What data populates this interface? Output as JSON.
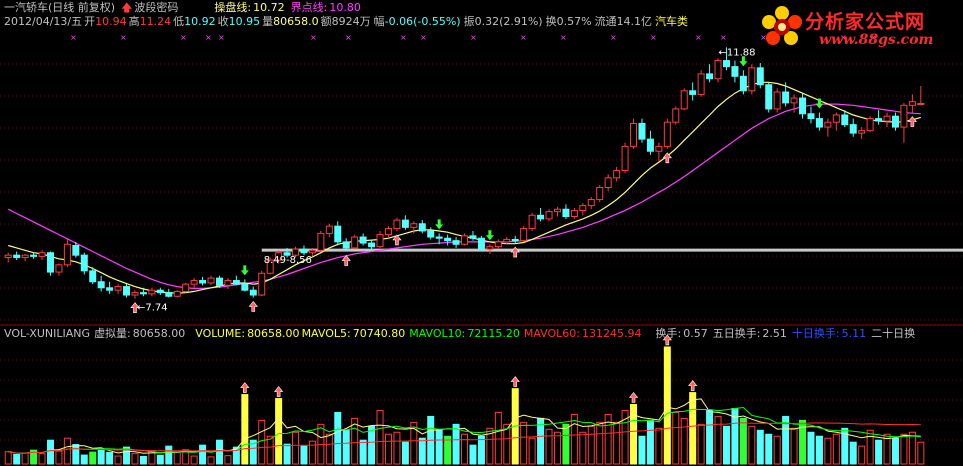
{
  "header": {
    "title": "一汽轿车(日线 前复权)",
    "indicator_name": "波段密码",
    "cao_pan_label": "操盘线:",
    "cao_pan_value": "10.72",
    "jie_dian_label": "界点线:",
    "jie_dian_value": "10.80"
  },
  "quote": {
    "date": "2012/04/13/五",
    "open_label": "开",
    "open": "10.94",
    "high_label": "高",
    "high": "11.24",
    "low_label": "低",
    "low": "10.92",
    "close_label": "收",
    "close": "10.95",
    "vol_label": "量",
    "volume": "80658.0",
    "amount_label": "额",
    "amount": "8924万",
    "change_label": "幅",
    "change": "-0.06(-0.55%)",
    "amplitude_label": "振",
    "amplitude": "0.32(2.91%)",
    "turnover_label": "换",
    "turnover": "0.57%",
    "float_label": "流通",
    "float_cap": "14.1亿",
    "sector": "汽车类"
  },
  "logo": {
    "name": "分析家公式网",
    "url": "www.88gs.com"
  },
  "volume_panel": {
    "indicator": "VOL-XUNILIANG",
    "virtual_vol_label": "虚拟量:",
    "virtual_vol": "80658.00",
    "volume_label": "VOLUME:",
    "volume": "80658.00",
    "mavol5_label": "MAVOL5:",
    "mavol5": "70740.80",
    "mavol10_label": "MAVOL10:",
    "mavol10": "72115.20",
    "mavol60_label": "MAVOL60:",
    "mavol60": "131245.94",
    "turn_label": "换手:",
    "turn": "0.57",
    "turn5_label": "五日换手:",
    "turn5": "2.51",
    "turn10_label": "十日换手:",
    "turn10": "5.11",
    "turn20_label": "二十日换"
  },
  "colors": {
    "up": "#ff3c3c",
    "down": "#54ffff",
    "ma_yellow": "#ffff80",
    "ma_magenta": "#ff40ff",
    "grid": "#800000",
    "text": "#c0c0c0",
    "green_text": "#00d000",
    "blue_text": "#3050ff",
    "mavol10_green": "#00ff00",
    "mavol60_red": "#ff3030",
    "yellow_bar": "#ffff40"
  },
  "chart_data": {
    "type": "candlestick",
    "annotations": [
      {
        "text": "11.88",
        "kind": "peak"
      },
      {
        "text": "7.74",
        "kind": "trough"
      },
      {
        "text": "8.49-8.56",
        "kind": "level"
      }
    ],
    "series": [
      {
        "name": "操盘线"
      },
      {
        "name": "界点线"
      }
    ],
    "candles": [
      [
        8.4,
        8.48,
        8.32,
        8.44
      ],
      [
        8.44,
        8.5,
        8.36,
        8.4
      ],
      [
        8.4,
        8.46,
        8.34,
        8.44
      ],
      [
        8.44,
        8.48,
        8.38,
        8.42
      ],
      [
        8.42,
        8.52,
        8.36,
        8.48
      ],
      [
        8.48,
        8.5,
        8.1,
        8.16
      ],
      [
        8.16,
        8.3,
        8.1,
        8.28
      ],
      [
        8.28,
        8.7,
        8.24,
        8.62
      ],
      [
        8.6,
        8.66,
        8.4,
        8.44
      ],
      [
        8.44,
        8.48,
        8.12,
        8.18
      ],
      [
        8.18,
        8.24,
        7.96,
        8.0
      ],
      [
        8.0,
        8.1,
        7.84,
        7.9
      ],
      [
        7.9,
        8.0,
        7.8,
        7.86
      ],
      [
        7.86,
        7.96,
        7.8,
        7.92
      ],
      [
        7.92,
        7.96,
        7.74,
        7.78
      ],
      [
        7.78,
        7.86,
        7.72,
        7.82
      ],
      [
        7.82,
        7.9,
        7.76,
        7.8
      ],
      [
        7.8,
        7.9,
        7.76,
        7.86
      ],
      [
        7.86,
        7.9,
        7.78,
        7.82
      ],
      [
        7.82,
        7.88,
        7.74,
        7.76
      ],
      [
        7.76,
        7.86,
        7.74,
        7.84
      ],
      [
        7.84,
        7.98,
        7.82,
        7.96
      ],
      [
        7.96,
        8.06,
        7.9,
        8.02
      ],
      [
        8.02,
        8.08,
        7.94,
        7.98
      ],
      [
        7.98,
        8.1,
        7.94,
        8.06
      ],
      [
        8.06,
        8.1,
        7.9,
        7.94
      ],
      [
        7.94,
        8.06,
        7.88,
        8.02
      ],
      [
        8.02,
        8.1,
        7.94,
        7.96
      ],
      [
        7.96,
        8.04,
        7.84,
        7.86
      ],
      [
        7.86,
        7.92,
        7.74,
        7.78
      ],
      [
        7.78,
        8.18,
        7.76,
        8.14
      ],
      [
        8.14,
        8.4,
        8.12,
        8.36
      ],
      [
        8.36,
        8.52,
        8.3,
        8.48
      ],
      [
        8.48,
        8.56,
        8.4,
        8.44
      ],
      [
        8.44,
        8.58,
        8.4,
        8.54
      ],
      [
        8.54,
        8.6,
        8.44,
        8.48
      ],
      [
        8.48,
        8.56,
        8.42,
        8.52
      ],
      [
        8.52,
        8.84,
        8.5,
        8.8
      ],
      [
        8.8,
        8.96,
        8.74,
        8.92
      ],
      [
        8.92,
        9.0,
        8.6,
        8.66
      ],
      [
        8.66,
        8.72,
        8.5,
        8.56
      ],
      [
        8.56,
        8.78,
        8.54,
        8.74
      ],
      [
        8.74,
        8.8,
        8.6,
        8.64
      ],
      [
        8.64,
        8.7,
        8.54,
        8.58
      ],
      [
        8.58,
        8.84,
        8.56,
        8.78
      ],
      [
        8.78,
        8.92,
        8.72,
        8.88
      ],
      [
        8.88,
        9.06,
        8.84,
        9.02
      ],
      [
        9.02,
        9.1,
        8.86,
        8.9
      ],
      [
        8.9,
        9.0,
        8.8,
        8.96
      ],
      [
        8.96,
        9.02,
        8.8,
        8.84
      ],
      [
        8.84,
        8.9,
        8.7,
        8.74
      ],
      [
        8.74,
        8.8,
        8.62,
        8.72
      ],
      [
        8.72,
        8.78,
        8.6,
        8.68
      ],
      [
        8.68,
        8.74,
        8.56,
        8.62
      ],
      [
        8.62,
        8.8,
        8.6,
        8.76
      ],
      [
        8.76,
        8.84,
        8.68,
        8.72
      ],
      [
        8.72,
        8.76,
        8.5,
        8.54
      ],
      [
        8.54,
        8.62,
        8.46,
        8.58
      ],
      [
        8.58,
        8.7,
        8.54,
        8.66
      ],
      [
        8.66,
        8.74,
        8.62,
        8.7
      ],
      [
        8.7,
        8.76,
        8.64,
        8.68
      ],
      [
        8.68,
        8.92,
        8.66,
        8.88
      ],
      [
        8.88,
        9.14,
        8.84,
        9.1
      ],
      [
        9.1,
        9.22,
        9.0,
        9.04
      ],
      [
        9.04,
        9.2,
        9.0,
        9.16
      ],
      [
        9.16,
        9.24,
        9.08,
        9.2
      ],
      [
        9.2,
        9.28,
        9.04,
        9.08
      ],
      [
        9.08,
        9.22,
        9.04,
        9.18
      ],
      [
        9.18,
        9.3,
        9.1,
        9.26
      ],
      [
        9.26,
        9.4,
        9.2,
        9.36
      ],
      [
        9.36,
        9.6,
        9.32,
        9.56
      ],
      [
        9.56,
        9.78,
        9.5,
        9.72
      ],
      [
        9.72,
        9.9,
        9.66,
        9.84
      ],
      [
        9.84,
        10.3,
        9.8,
        10.24
      ],
      [
        10.24,
        10.7,
        10.2,
        10.62
      ],
      [
        10.62,
        10.7,
        10.3,
        10.36
      ],
      [
        10.36,
        10.5,
        10.1,
        10.16
      ],
      [
        10.16,
        10.3,
        10.0,
        10.24
      ],
      [
        10.24,
        10.7,
        10.2,
        10.64
      ],
      [
        10.64,
        10.9,
        10.6,
        10.86
      ],
      [
        10.86,
        11.2,
        10.84,
        11.16
      ],
      [
        11.16,
        11.3,
        11.0,
        11.1
      ],
      [
        11.1,
        11.5,
        11.06,
        11.44
      ],
      [
        11.44,
        11.6,
        11.3,
        11.36
      ],
      [
        11.36,
        11.7,
        11.3,
        11.66
      ],
      [
        11.66,
        11.88,
        11.5,
        11.56
      ],
      [
        11.56,
        11.66,
        11.3,
        11.4
      ],
      [
        11.4,
        11.5,
        11.1,
        11.16
      ],
      [
        11.16,
        11.6,
        11.1,
        11.54
      ],
      [
        11.54,
        11.62,
        11.2,
        11.26
      ],
      [
        11.26,
        11.3,
        10.8,
        10.86
      ],
      [
        10.86,
        11.2,
        10.8,
        11.14
      ],
      [
        11.14,
        11.3,
        10.9,
        10.96
      ],
      [
        10.96,
        11.1,
        10.8,
        11.04
      ],
      [
        11.04,
        11.12,
        10.7,
        10.78
      ],
      [
        10.78,
        10.9,
        10.62,
        10.7
      ],
      [
        10.7,
        10.8,
        10.5,
        10.56
      ],
      [
        10.56,
        10.7,
        10.4,
        10.64
      ],
      [
        10.64,
        10.8,
        10.5,
        10.76
      ],
      [
        10.76,
        10.84,
        10.56,
        10.6
      ],
      [
        10.6,
        10.7,
        10.4,
        10.46
      ],
      [
        10.46,
        10.56,
        10.36,
        10.5
      ],
      [
        10.5,
        10.74,
        10.48,
        10.7
      ],
      [
        10.7,
        10.84,
        10.6,
        10.66
      ],
      [
        10.66,
        10.8,
        10.56,
        10.74
      ],
      [
        10.74,
        10.8,
        10.5,
        10.56
      ],
      [
        10.56,
        10.96,
        10.3,
        10.92
      ],
      [
        10.92,
        11.1,
        10.8,
        10.98
      ],
      [
        10.94,
        11.24,
        10.92,
        10.95
      ]
    ],
    "ma_short": [
      8.6,
      8.56,
      8.52,
      8.48,
      8.46,
      8.42,
      8.38,
      8.36,
      8.33,
      8.28,
      8.22,
      8.15,
      8.08,
      8.02,
      7.97,
      7.92,
      7.88,
      7.85,
      7.83,
      7.82,
      7.81,
      7.82,
      7.84,
      7.87,
      7.9,
      7.93,
      7.96,
      7.98,
      7.98,
      7.96,
      7.98,
      8.04,
      8.12,
      8.2,
      8.28,
      8.35,
      8.41,
      8.48,
      8.56,
      8.62,
      8.65,
      8.67,
      8.68,
      8.69,
      8.7,
      8.72,
      8.76,
      8.8,
      8.84,
      8.86,
      8.86,
      8.84,
      8.82,
      8.78,
      8.75,
      8.72,
      8.69,
      8.66,
      8.64,
      8.63,
      8.63,
      8.65,
      8.7,
      8.76,
      8.82,
      8.88,
      8.94,
      8.99,
      9.04,
      9.1,
      9.17,
      9.26,
      9.36,
      9.48,
      9.62,
      9.76,
      9.88,
      9.98,
      10.08,
      10.2,
      10.34,
      10.48,
      10.62,
      10.76,
      10.9,
      11.02,
      11.12,
      11.2,
      11.26,
      11.3,
      11.3,
      11.28,
      11.24,
      11.18,
      11.12,
      11.06,
      11.0,
      10.94,
      10.88,
      10.82,
      10.76,
      10.72,
      10.68,
      10.66,
      10.65,
      10.64,
      10.65,
      10.68,
      10.72
    ],
    "ma_long": [
      9.2,
      9.13,
      9.06,
      8.99,
      8.92,
      8.85,
      8.78,
      8.71,
      8.64,
      8.57,
      8.5,
      8.43,
      8.36,
      8.29,
      8.22,
      8.16,
      8.1,
      8.04,
      7.99,
      7.95,
      7.92,
      7.9,
      7.89,
      7.89,
      7.9,
      7.91,
      7.93,
      7.95,
      7.97,
      7.99,
      8.01,
      8.04,
      8.08,
      8.12,
      8.17,
      8.22,
      8.27,
      8.32,
      8.36,
      8.4,
      8.43,
      8.46,
      8.48,
      8.5,
      8.52,
      8.54,
      8.56,
      8.58,
      8.6,
      8.62,
      8.63,
      8.64,
      8.65,
      8.66,
      8.66,
      8.66,
      8.66,
      8.66,
      8.66,
      8.66,
      8.67,
      8.68,
      8.7,
      8.72,
      8.75,
      8.78,
      8.82,
      8.86,
      8.9,
      8.95,
      9.0,
      9.06,
      9.12,
      9.18,
      9.25,
      9.32,
      9.4,
      9.48,
      9.56,
      9.65,
      9.74,
      9.84,
      9.94,
      10.04,
      10.14,
      10.24,
      10.34,
      10.44,
      10.54,
      10.62,
      10.7,
      10.76,
      10.82,
      10.86,
      10.9,
      10.92,
      10.94,
      10.94,
      10.94,
      10.93,
      10.92,
      10.9,
      10.88,
      10.86,
      10.84,
      10.82,
      10.8,
      10.79,
      10.78
    ],
    "volumes": [
      62,
      48,
      55,
      70,
      52,
      120,
      65,
      130,
      98,
      45,
      60,
      75,
      58,
      40,
      85,
      52,
      38,
      66,
      44,
      90,
      58,
      72,
      40,
      95,
      36,
      120,
      42,
      85,
      350,
      120,
      220,
      140,
      330,
      100,
      160,
      90,
      115,
      200,
      150,
      260,
      170,
      230,
      120,
      190,
      270,
      150,
      160,
      110,
      210,
      130,
      240,
      170,
      140,
      200,
      150,
      95,
      140,
      180,
      260,
      200,
      380,
      210,
      130,
      230,
      175,
      160,
      200,
      250,
      160,
      190,
      210,
      250,
      210,
      270,
      300,
      140,
      220,
      180,
      590,
      260,
      230,
      360,
      200,
      270,
      240,
      190,
      280,
      230,
      190,
      170,
      150,
      140,
      240,
      180,
      220,
      160,
      140,
      130,
      150,
      180,
      110,
      90,
      170,
      120,
      150,
      130,
      150,
      160,
      110
    ],
    "vol_ylim": [
      0,
      600
    ],
    "ylim": [
      7.4,
      12.1
    ],
    "buy_signals": [
      15,
      29,
      40,
      46,
      60,
      78,
      107
    ],
    "sell_signals": [
      28,
      51,
      57,
      87,
      96
    ]
  }
}
